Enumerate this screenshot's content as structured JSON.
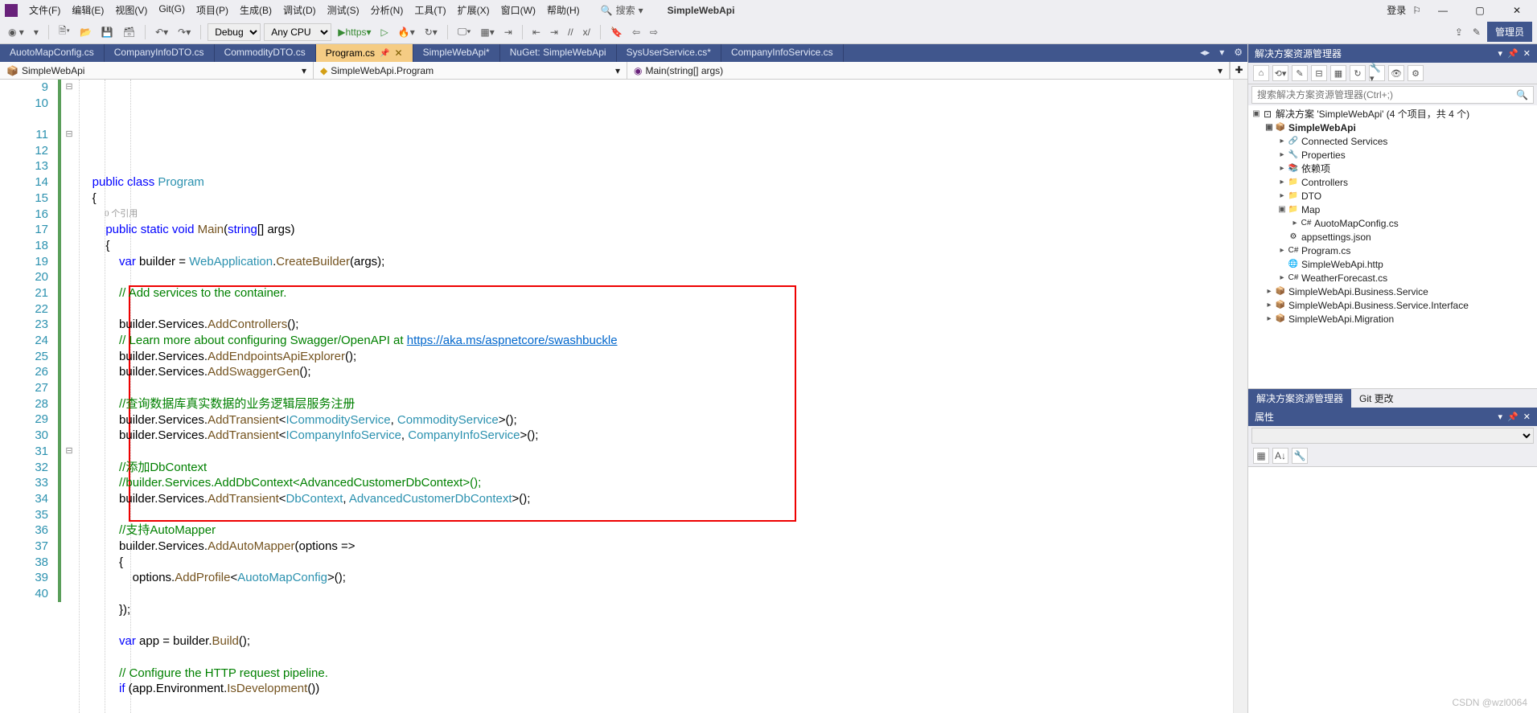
{
  "menu": {
    "items": [
      "文件(F)",
      "编辑(E)",
      "视图(V)",
      "Git(G)",
      "项目(P)",
      "生成(B)",
      "调试(D)",
      "测试(S)",
      "分析(N)",
      "工具(T)",
      "扩展(X)",
      "窗口(W)",
      "帮助(H)"
    ]
  },
  "search_label": "搜索",
  "app_name": "SimpleWebApi",
  "login": "登录",
  "admin_btn": "管理员",
  "toolbar": {
    "config": "Debug",
    "platform": "Any CPU",
    "run": "https"
  },
  "tabs": [
    {
      "label": "AuotoMapConfig.cs"
    },
    {
      "label": "CompanyInfoDTO.cs"
    },
    {
      "label": "CommodityDTO.cs"
    },
    {
      "label": "Program.cs",
      "active": true
    },
    {
      "label": "SimpleWebApi*"
    },
    {
      "label": "NuGet: SimpleWebApi"
    },
    {
      "label": "SysUserService.cs*"
    },
    {
      "label": "CompanyInfoService.cs"
    }
  ],
  "crumbs": {
    "a": "SimpleWebApi",
    "b": "SimpleWebApi.Program",
    "c": "Main(string[] args)"
  },
  "codelens": "0 个引用",
  "lines": [
    {
      "n": 9,
      "html": "<span class='kw'>public</span> <span class='kw'>class</span> <span class='type'>Program</span>"
    },
    {
      "n": 10,
      "html": "{"
    },
    {
      "n": "",
      "html": "",
      "codelens": true
    },
    {
      "n": 11,
      "html": "    <span class='kw'>public</span> <span class='kw'>static</span> <span class='kw'>void</span> <span class='method'>Main</span>(<span class='kw'>string</span>[] args)"
    },
    {
      "n": 12,
      "html": "    {"
    },
    {
      "n": 13,
      "html": "        <span class='kw'>var</span> builder = <span class='type'>WebApplication</span>.<span class='method'>CreateBuilder</span>(args);"
    },
    {
      "n": 14,
      "html": ""
    },
    {
      "n": 15,
      "html": "        <span class='comment'>// Add services to the container.</span>"
    },
    {
      "n": 16,
      "html": ""
    },
    {
      "n": 17,
      "html": "        builder.Services.<span class='method'>AddControllers</span>();"
    },
    {
      "n": 18,
      "html": "        <span class='comment'>// Learn more about configuring Swagger/OpenAPI at </span><span class='url'>https://aka.ms/aspnetcore/swashbuckle</span>"
    },
    {
      "n": 19,
      "html": "        builder.Services.<span class='method'>AddEndpointsApiExplorer</span>();"
    },
    {
      "n": 20,
      "html": "        builder.Services.<span class='method'>AddSwaggerGen</span>();"
    },
    {
      "n": 21,
      "html": ""
    },
    {
      "n": 22,
      "html": "        <span class='comment'>//查询数据库真实数据的业务逻辑层服务注册</span>"
    },
    {
      "n": 23,
      "html": "        builder.Services.<span class='method'>AddTransient</span>&lt;<span class='type'>ICommodityService</span>, <span class='type'>CommodityService</span>&gt;();"
    },
    {
      "n": 24,
      "html": "        builder.Services.<span class='method'>AddTransient</span>&lt;<span class='type'>ICompanyInfoService</span>, <span class='type'>CompanyInfoService</span>&gt;();"
    },
    {
      "n": 25,
      "html": ""
    },
    {
      "n": 26,
      "html": "        <span class='comment'>//添加DbContext</span>"
    },
    {
      "n": 27,
      "html": "        <span class='comment'>//builder.Services.AddDbContext&lt;AdvancedCustomerDbContext&gt;();</span>"
    },
    {
      "n": 28,
      "html": "        builder.Services.<span class='method'>AddTransient</span>&lt;<span class='type'>DbContext</span>, <span class='type'>AdvancedCustomerDbContext</span>&gt;();"
    },
    {
      "n": 29,
      "html": ""
    },
    {
      "n": 30,
      "html": "        <span class='comment'>//支持AutoMapper</span>"
    },
    {
      "n": 31,
      "html": "        builder.Services.<span class='method'>AddAutoMapper</span>(options =&gt;"
    },
    {
      "n": 32,
      "html": "        {"
    },
    {
      "n": 33,
      "html": "            options.<span class='method'>AddProfile</span>&lt;<span class='type'>AuotoMapConfig</span>&gt;();"
    },
    {
      "n": 34,
      "html": ""
    },
    {
      "n": 35,
      "html": "        });"
    },
    {
      "n": 36,
      "html": ""
    },
    {
      "n": 37,
      "html": "        <span class='kw'>var</span> app = builder.<span class='method'>Build</span>();"
    },
    {
      "n": 38,
      "html": ""
    },
    {
      "n": 39,
      "html": "        <span class='comment'>// Configure the HTTP request pipeline.</span>"
    },
    {
      "n": 40,
      "html": "        <span class='kw'>if</span> (app.Environment.<span class='method'>IsDevelopment</span>())"
    }
  ],
  "solution": {
    "title": "解决方案资源管理器",
    "search_placeholder": "搜索解决方案资源管理器(Ctrl+;)",
    "root": "解决方案 'SimpleWebApi' (4 个项目，共 4 个)",
    "nodes": [
      {
        "indent": 1,
        "exp": "▣",
        "ico": "📦",
        "label": "SimpleWebApi",
        "bold": true
      },
      {
        "indent": 2,
        "exp": "▸",
        "ico": "🔗",
        "label": "Connected Services"
      },
      {
        "indent": 2,
        "exp": "▸",
        "ico": "🔧",
        "label": "Properties"
      },
      {
        "indent": 2,
        "exp": "▸",
        "ico": "📚",
        "label": "依赖项"
      },
      {
        "indent": 2,
        "exp": "▸",
        "ico": "📁",
        "label": "Controllers"
      },
      {
        "indent": 2,
        "exp": "▸",
        "ico": "📁",
        "label": "DTO"
      },
      {
        "indent": 2,
        "exp": "▣",
        "ico": "📁",
        "label": "Map"
      },
      {
        "indent": 3,
        "exp": "▸",
        "ico": "C#",
        "label": "AuotoMapConfig.cs"
      },
      {
        "indent": 2,
        "exp": "",
        "ico": "⚙",
        "label": "appsettings.json"
      },
      {
        "indent": 2,
        "exp": "▸",
        "ico": "C#",
        "label": "Program.cs"
      },
      {
        "indent": 2,
        "exp": "",
        "ico": "🌐",
        "label": "SimpleWebApi.http"
      },
      {
        "indent": 2,
        "exp": "▸",
        "ico": "C#",
        "label": "WeatherForecast.cs"
      },
      {
        "indent": 1,
        "exp": "▸",
        "ico": "📦",
        "label": "SimpleWebApi.Business.Service"
      },
      {
        "indent": 1,
        "exp": "▸",
        "ico": "📦",
        "label": "SimpleWebApi.Business.Service.Interface"
      },
      {
        "indent": 1,
        "exp": "▸",
        "ico": "📦",
        "label": "SimpleWebApi.Migration"
      }
    ],
    "bottom_tabs": [
      "解决方案资源管理器",
      "Git 更改"
    ]
  },
  "props_title": "属性",
  "watermark": "CSDN @wzl0064"
}
